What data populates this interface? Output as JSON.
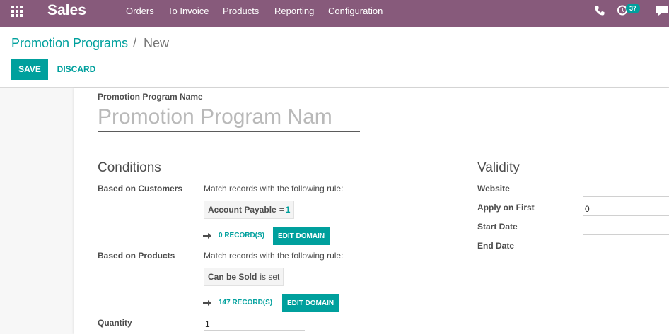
{
  "navbar": {
    "app_name": "Sales",
    "menu": [
      "Orders",
      "To Invoice",
      "Products",
      "Reporting",
      "Configuration"
    ],
    "activity_count": "37",
    "icons": [
      "apps-grid-icon",
      "phone-icon",
      "activity-clock-icon",
      "chat-icon"
    ],
    "color": "#875a7b"
  },
  "breadcrumb": {
    "parent": "Promotion Programs",
    "separator": "/",
    "current": "New"
  },
  "buttons": {
    "save": "Save",
    "discard": "Discard"
  },
  "form": {
    "name_label": "Promotion Program Name",
    "name_placeholder": "Promotion Program Nam",
    "conditions": {
      "title": "Conditions",
      "customers": {
        "label": "Based on Customers",
        "rule_text": "Match records with the following rule:",
        "field": "Account Payable",
        "operator": "=",
        "value": "1",
        "records": "0 record(s)",
        "edit": "Edit Domain"
      },
      "products": {
        "label": "Based on Products",
        "rule_text": "Match records with the following rule:",
        "field": "Can be Sold",
        "operator": "is set",
        "records": "147 record(s)",
        "edit": "Edit Domain"
      },
      "quantity": {
        "label": "Quantity",
        "value": "1"
      }
    },
    "validity": {
      "title": "Validity",
      "website_label": "Website",
      "apply_first_label": "Apply on First",
      "apply_first_value": "0",
      "start_date_label": "Start Date",
      "end_date_label": "End Date"
    }
  },
  "colors": {
    "accent": "#00a09d",
    "brand": "#875a7b"
  }
}
